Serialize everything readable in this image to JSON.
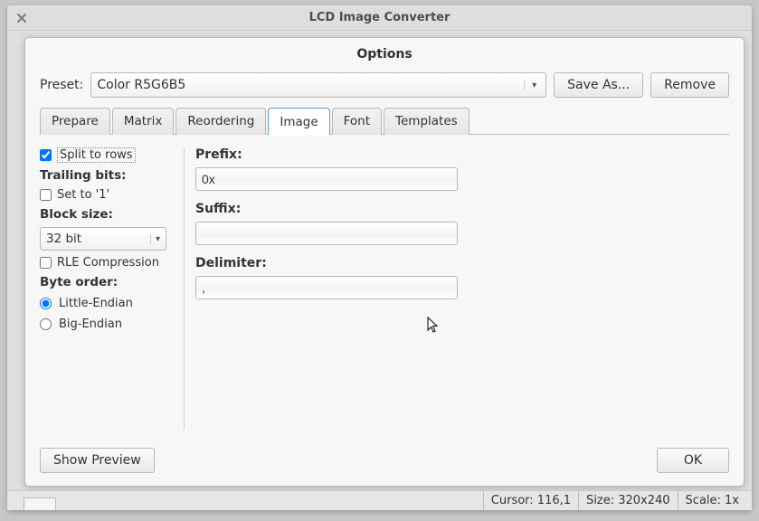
{
  "window": {
    "title": "LCD Image Converter"
  },
  "dialog": {
    "title": "Options",
    "preset_label": "Preset:",
    "preset_value": "Color R5G6B5",
    "save_as": "Save As...",
    "remove": "Remove",
    "tabs": {
      "prepare": "Prepare",
      "matrix": "Matrix",
      "reordering": "Reordering",
      "image": "Image",
      "font": "Font",
      "templates": "Templates"
    },
    "left": {
      "split_to_rows": "Split to rows",
      "trailing_bits": "Trailing bits:",
      "set_to_1": "Set to '1'",
      "block_size": "Block size:",
      "block_size_value": "32 bit",
      "rle": "RLE Compression",
      "byte_order": "Byte order:",
      "little_endian": "Little-Endian",
      "big_endian": "Big-Endian"
    },
    "right": {
      "prefix_label": "Prefix:",
      "prefix_value": "0x",
      "suffix_label": "Suffix:",
      "suffix_value": "",
      "delimiter_label": "Delimiter:",
      "delimiter_value": ","
    },
    "footer": {
      "show_preview": "Show Preview",
      "ok": "OK"
    }
  },
  "status": {
    "cursor": "Cursor: 116,1",
    "size": "Size: 320x240",
    "scale": "Scale: 1x"
  }
}
